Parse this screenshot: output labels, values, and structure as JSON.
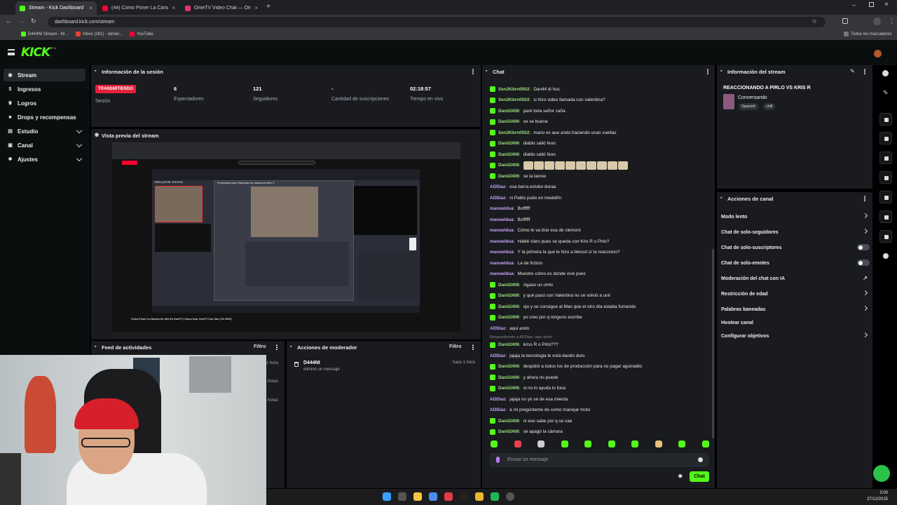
{
  "browser": {
    "tabs": [
      {
        "title": "Stream - Kick Dashboard",
        "active": true
      },
      {
        "title": "(44) Cómo Poner La Cámara De"
      },
      {
        "title": "OmeTV Video Chat — Ome"
      }
    ],
    "url": "dashboard.kick.com/stream",
    "bookmarks": [
      "D444NI Stream - W...",
      "Inbox (281) - daniel...",
      "YouTube"
    ],
    "all_bookmarks": "Todos los marcadores"
  },
  "app": {
    "logo": "KICK",
    "logo_badge": "BETA"
  },
  "sidebar": {
    "items": [
      {
        "label": "Stream",
        "icon": "broadcast-icon"
      },
      {
        "label": "Ingresos",
        "icon": "dollar-icon"
      },
      {
        "label": "Logros",
        "icon": "trophy-icon"
      },
      {
        "label": "Drops y recompensas",
        "icon": "gift-icon"
      },
      {
        "label": "Estudio",
        "icon": "studio-icon"
      },
      {
        "label": "Canal",
        "icon": "channel-icon"
      },
      {
        "label": "Ajustes",
        "icon": "gear-icon"
      }
    ]
  },
  "session": {
    "title": "Información de la sesión",
    "status_badge": "TRANSMITIENDO",
    "stats": [
      {
        "value": "",
        "label": "Sesión"
      },
      {
        "value": "6",
        "label": "Espectadores"
      },
      {
        "value": "121",
        "label": "Seguidores"
      },
      {
        "value": "-",
        "label": "Cantidad de suscripciones"
      },
      {
        "value": "02:18:57",
        "label": "Tiempo en vivo"
      }
    ]
  },
  "preview": {
    "title": "Vista previa del stream",
    "inner_scene_label": "Vista previa: Escena",
    "inner_dialog_title": "Propiedades para 'Dispositivo de captura de vídeo 2'",
    "video_title": "Cómo Poner La Cámara De Obs En OmeTV | Cómo Usar OmeTV Con Obs ( En 2025 )"
  },
  "activity": {
    "title": "Feed de actividades",
    "filter": "Filtro",
    "times": [
      "1 hora",
      "horas",
      "horas"
    ]
  },
  "mod_actions": {
    "title": "Acciones de moderador",
    "filter": "Filtro",
    "entries": [
      {
        "user": "D444NI",
        "action": "eliminó un mensaje",
        "time": "hace 1 hora"
      }
    ]
  },
  "chat": {
    "title": "Chat",
    "messages": [
      {
        "user": "Sen2Kbrn0502",
        "text": "Dan44 di huc",
        "badge": true
      },
      {
        "user": "Sen2Kbrn0502",
        "text": "si hizo video llamada con valentina?",
        "badge": true
      },
      {
        "user": "Danii2406",
        "text": "paré bola señor caña",
        "badge": true
      },
      {
        "user": "Danii2406",
        "text": "se ve buena",
        "badge": true
      },
      {
        "user": "Sen2Kbrn0502",
        "text": "mano es aue ando haciendo unas vueltas",
        "badge": true
      },
      {
        "user": "Danii2406",
        "text": "diablo salió feoo",
        "badge": true
      },
      {
        "user": "Danii2406",
        "text": "diablo salió feoo",
        "badge": true
      },
      {
        "user": "Danii2406",
        "text": "",
        "badge": true,
        "emotes": 10
      },
      {
        "user": "Danii2406",
        "text": "se la lacreo",
        "badge": true
      },
      {
        "user": "ADDiaz",
        "text": "esa barra estubo duraa",
        "badge": false
      },
      {
        "user": "ADDiaz",
        "text": "ni Pablo pudo en medellín",
        "badge": false
      },
      {
        "user": "manueldua",
        "text": "Boffffff",
        "badge": false
      },
      {
        "user": "manueldua",
        "text": "Boffffff",
        "badge": false
      },
      {
        "user": "manueldua",
        "text": "Cómo le va tirar esa de clemont",
        "badge": false
      },
      {
        "user": "manueldua",
        "text": "Hablé claro pues se queda con Kris R o Pirlo?",
        "badge": false
      },
      {
        "user": "manueldua",
        "text": "Y la primera la que le hizo a blessd sí la reacciono?",
        "badge": false
      },
      {
        "user": "manueldua",
        "text": "La de ficticio",
        "badge": false
      },
      {
        "user": "manueldua",
        "text": "Muestre cómo es donde vive pues",
        "badge": false
      },
      {
        "user": "Danii2406",
        "text": "Agase un omtv",
        "badge": true
      },
      {
        "user": "Danii2406",
        "text": "y qué pasó con Valentina no se volvió a unir",
        "badge": true
      },
      {
        "user": "Danii2406",
        "text": "ojo y se consigue al Man que el otro día estaba fumando",
        "badge": true
      },
      {
        "user": "Danii2406",
        "text": "yo creo por q ninguno escribe",
        "badge": true
      },
      {
        "user": "ADDiaz",
        "text": "aqui ando",
        "badge": false
      },
      {
        "user": "Danii2406",
        "text": "kriss R o Pirlo???",
        "badge": true,
        "reply": "Respondiendo a ADDiaz: aqui ando"
      },
      {
        "user": "ADDiaz",
        "text": "jajaja la tecnologia le está dando duro",
        "badge": false
      },
      {
        "user": "Danii2406",
        "text": "despidió a todos los de producción para no pagar aguinaldo",
        "badge": true
      },
      {
        "user": "Danii2406",
        "text": "y ahora no puede",
        "badge": true
      },
      {
        "user": "Danii2406",
        "text": "si no lo ayuda lo funa",
        "badge": true
      },
      {
        "user": "ADDiaz",
        "text": "jajaja no yo sé de esa mierda",
        "badge": false
      },
      {
        "user": "ADDiaz",
        "text": "a mi pregúnteme de como manejar moto",
        "badge": false
      },
      {
        "user": "Danii2406",
        "text": "ni eso sabe por q se cae",
        "badge": true
      },
      {
        "user": "Danii2406",
        "text": "se apagó la cámara",
        "badge": true
      }
    ],
    "input_placeholder": "Enviar un mensaje",
    "send_label": "Chat",
    "colors": {
      "green": "#53fc18",
      "user_green": "#9be07a",
      "user_purple": "#c9a2f5"
    }
  },
  "stream_info": {
    "title": "Información del stream",
    "stream_title": "REACCIONANDO A PIRLO VS KRIS R",
    "category": "Conversando",
    "tags": [
      "Spanish",
      "chill"
    ]
  },
  "channel_actions": {
    "title": "Acciones de canal",
    "items": [
      {
        "label": "Modo lento",
        "control": "arrow"
      },
      {
        "label": "Chat de solo-seguidores",
        "control": "arrow"
      },
      {
        "label": "Chat de solo-suscriptores",
        "control": "toggle"
      },
      {
        "label": "Chat de solo-emotes",
        "control": "toggle"
      },
      {
        "label": "Moderación del chat con IA",
        "control": "external"
      },
      {
        "label": "Restricción de edad",
        "control": "arrow"
      },
      {
        "label": "Palabras baneadas",
        "control": "arrow"
      },
      {
        "label": "Hostear canal",
        "control": "none"
      },
      {
        "label": "Configurar objetivos",
        "control": "arrow"
      }
    ]
  },
  "taskbar": {
    "time": "3:00",
    "date": "27/12/2025"
  }
}
